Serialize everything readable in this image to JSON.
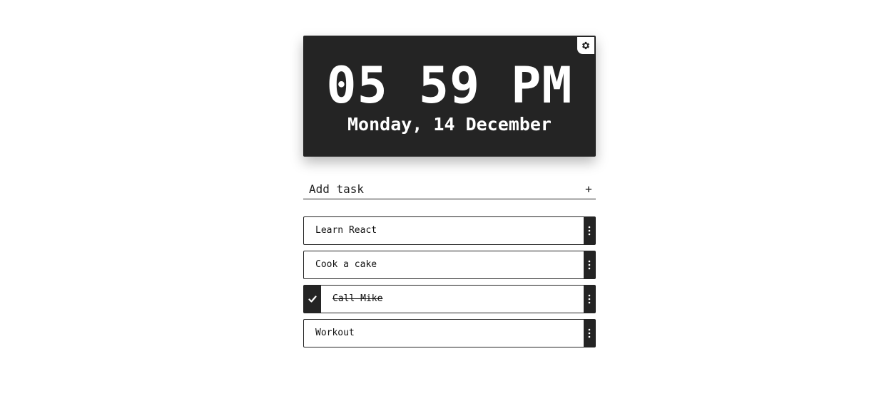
{
  "clock": {
    "time": "05 59 PM",
    "date": "Monday, 14 December"
  },
  "add_task": {
    "placeholder": "Add task",
    "add_symbol": "+"
  },
  "tasks": [
    {
      "label": "Learn React",
      "done": false
    },
    {
      "label": "Cook a cake",
      "done": false
    },
    {
      "label": "Call Mike",
      "done": true
    },
    {
      "label": "Workout",
      "done": false
    }
  ],
  "icons": {
    "settings": "gear-icon",
    "task_menu": "vertical-dots-icon",
    "done": "check-icon"
  },
  "colors": {
    "dark": "#242424",
    "background": "#ffffff",
    "text_light": "#ffffff"
  }
}
